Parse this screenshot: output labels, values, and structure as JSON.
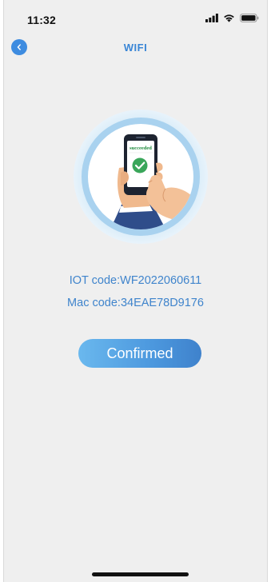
{
  "status_bar": {
    "time": "11:32"
  },
  "nav": {
    "title": "WIFI",
    "back_icon": "chevron-left-icon"
  },
  "illustration": {
    "phone_screen_text": "succeeded",
    "check_icon": "checkmark-icon"
  },
  "device": {
    "iot_code": "IOT code:WF2022060611",
    "mac_code": "Mac code:34EAE78D9176"
  },
  "actions": {
    "confirm_label": "Confirmed"
  },
  "colors": {
    "accent": "#3a86d6",
    "background": "#efefef",
    "success": "#3aa65a"
  }
}
